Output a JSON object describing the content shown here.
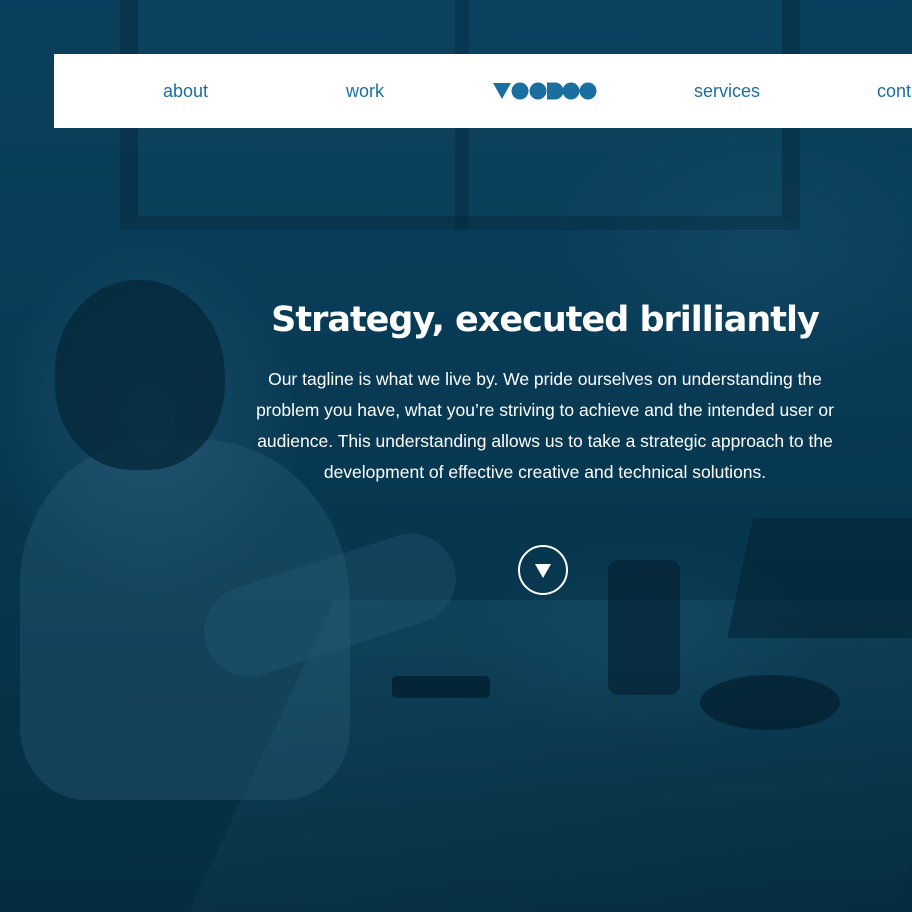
{
  "nav": {
    "links": [
      {
        "label": "about"
      },
      {
        "label": "work"
      },
      {
        "label": "services"
      },
      {
        "label": "contact"
      }
    ],
    "logo_text": "VOODOO"
  },
  "hero": {
    "title": "Strategy, executed brilliantly",
    "body": "Our tagline is what we live by. We pride ourselves on understanding the problem you have, what you’re striving to achieve and the intended user or audience. This understanding allows us to take a strategic approach to the development of effective creative and technical solutions.",
    "scroll_icon": "chevron-down-icon"
  },
  "colors": {
    "accent": "#1b6fa0",
    "overlay": "#0b3a52",
    "nav_background": "#ffffff",
    "hero_text": "#ffffff"
  }
}
